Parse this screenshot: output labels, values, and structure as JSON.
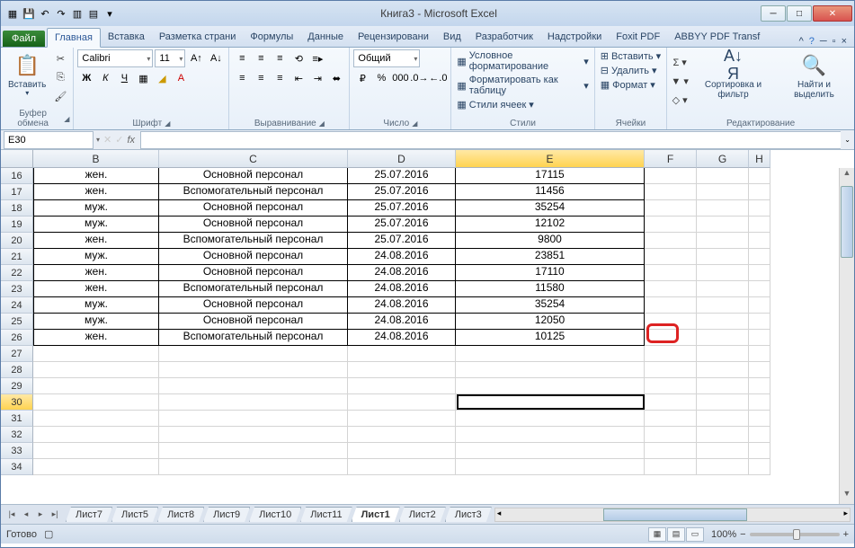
{
  "title": "Книга3  -  Microsoft Excel",
  "qat_icons": [
    "excel-icon",
    "save-icon",
    "undo-icon",
    "redo-icon",
    "new-icon",
    "open-icon",
    "customize-icon"
  ],
  "tabs": {
    "file": "Файл",
    "items": [
      "Главная",
      "Вставка",
      "Разметка страни",
      "Формулы",
      "Данные",
      "Рецензировани",
      "Вид",
      "Разработчик",
      "Надстройки",
      "Foxit PDF",
      "ABBYY PDF Transf"
    ],
    "active": 0
  },
  "ribbon": {
    "clipboard": {
      "label": "Буфер обмена",
      "paste": "Вставить"
    },
    "font": {
      "label": "Шрифт",
      "name": "Calibri",
      "size": "11"
    },
    "alignment": {
      "label": "Выравнивание"
    },
    "number": {
      "label": "Число",
      "format": "Общий"
    },
    "styles": {
      "label": "Стили",
      "cond": "Условное форматирование",
      "table": "Форматировать как таблицу",
      "cell": "Стили ячеек"
    },
    "cells": {
      "label": "Ячейки",
      "insert": "Вставить",
      "delete": "Удалить",
      "format": "Формат"
    },
    "editing": {
      "label": "Редактирование",
      "sort": "Сортировка и фильтр",
      "find": "Найти и выделить"
    }
  },
  "name_box": "E30",
  "columns": [
    "B",
    "C",
    "D",
    "E",
    "F",
    "G",
    "H"
  ],
  "selected_col": "E",
  "selected_row": 30,
  "rows": [
    {
      "n": 16,
      "b": "жен.",
      "c": "Основной персонал",
      "d": "25.07.2016",
      "e": "17115"
    },
    {
      "n": 17,
      "b": "жен.",
      "c": "Вспомогательный персонал",
      "d": "25.07.2016",
      "e": "11456"
    },
    {
      "n": 18,
      "b": "муж.",
      "c": "Основной персонал",
      "d": "25.07.2016",
      "e": "35254"
    },
    {
      "n": 19,
      "b": "муж.",
      "c": "Основной персонал",
      "d": "25.07.2016",
      "e": "12102"
    },
    {
      "n": 20,
      "b": "жен.",
      "c": "Вспомогательный персонал",
      "d": "25.07.2016",
      "e": "9800"
    },
    {
      "n": 21,
      "b": "муж.",
      "c": "Основной персонал",
      "d": "24.08.2016",
      "e": "23851"
    },
    {
      "n": 22,
      "b": "жен.",
      "c": "Основной персонал",
      "d": "24.08.2016",
      "e": "17110"
    },
    {
      "n": 23,
      "b": "жен.",
      "c": "Вспомогательный персонал",
      "d": "24.08.2016",
      "e": "11580"
    },
    {
      "n": 24,
      "b": "муж.",
      "c": "Основной персонал",
      "d": "24.08.2016",
      "e": "35254"
    },
    {
      "n": 25,
      "b": "муж.",
      "c": "Основной персонал",
      "d": "24.08.2016",
      "e": "12050"
    },
    {
      "n": 26,
      "b": "жен.",
      "c": "Вспомогательный персонал",
      "d": "24.08.2016",
      "e": "10125"
    }
  ],
  "empty_rows": [
    27,
    28,
    29,
    30,
    31,
    32,
    33,
    34
  ],
  "sheet_tabs": [
    "Лист7",
    "Лист5",
    "Лист8",
    "Лист9",
    "Лист10",
    "Лист11",
    "Лист1",
    "Лист2",
    "Лист3"
  ],
  "active_sheet": 6,
  "status": "Готово",
  "zoom": "100%"
}
